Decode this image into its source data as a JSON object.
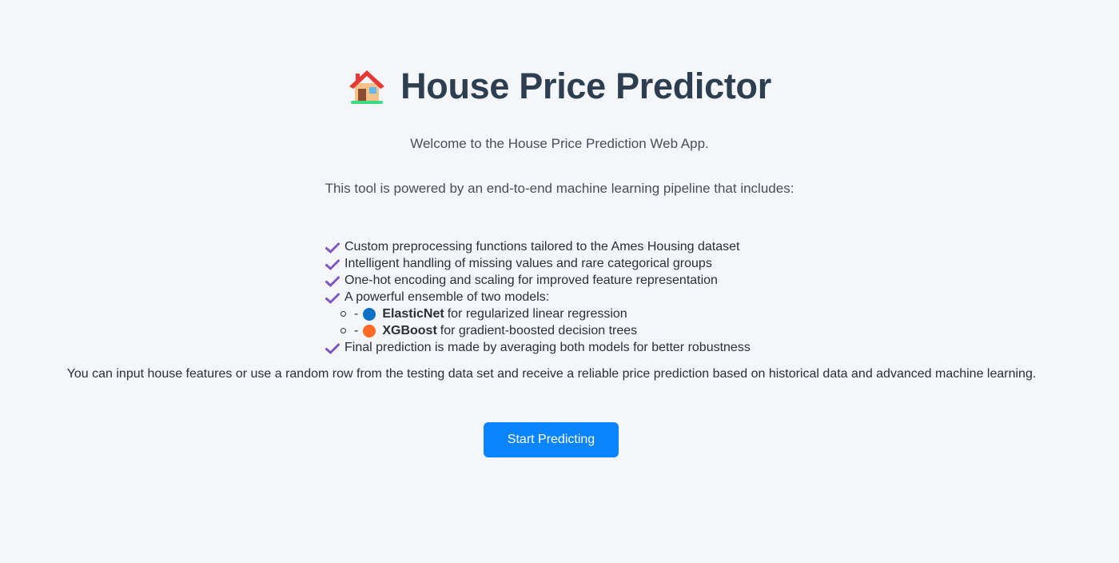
{
  "header": {
    "title": "House Price Predictor",
    "icon": "house-icon"
  },
  "welcome": "Welcome to the House Price Prediction Web App.",
  "intro": "This tool is powered by an end-to-end machine learning pipeline that includes:",
  "features": [
    "Custom preprocessing functions tailored to the Ames Housing dataset",
    "Intelligent handling of missing values and rare categorical groups",
    "One-hot encoding and scaling for improved feature representation",
    "A powerful ensemble of two models:",
    "Final prediction is made by averaging both models for better robustness"
  ],
  "models": [
    {
      "dash": "-",
      "name": "ElasticNet",
      "description": "for regularized linear regression",
      "color": "#0b72c6"
    },
    {
      "dash": "-",
      "name": "XGBoost",
      "description": "for gradient-boosted decision trees",
      "color": "#ff6a25"
    }
  ],
  "closing": "You can input house features or use a random row from the testing data set and receive a reliable price prediction based on historical data and advanced machine learning.",
  "button": {
    "label": "Start Predicting",
    "color": "#0a84ff"
  },
  "colors": {
    "check": "#7e57c2",
    "background": "#f4f6f9",
    "title": "#2c3e50"
  }
}
